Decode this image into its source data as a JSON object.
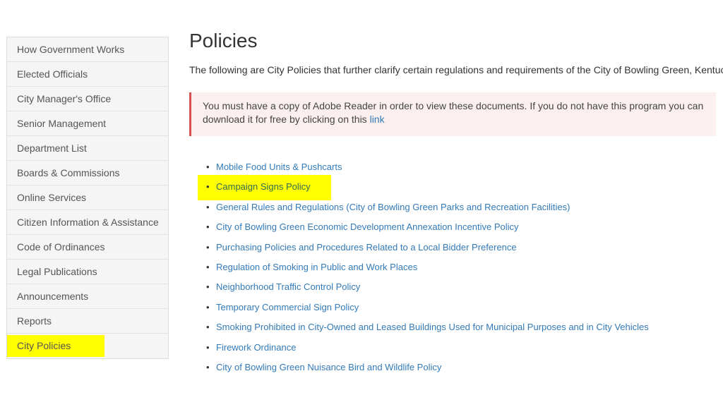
{
  "sidebar": {
    "items": [
      {
        "label": "How Government Works"
      },
      {
        "label": "Elected Officials"
      },
      {
        "label": "City Manager's Office"
      },
      {
        "label": "Senior Management"
      },
      {
        "label": "Department List"
      },
      {
        "label": "Boards & Commissions"
      },
      {
        "label": "Online Services"
      },
      {
        "label": "Citizen Information & Assistance"
      },
      {
        "label": "Code of Ordinances"
      },
      {
        "label": "Legal Publications"
      },
      {
        "label": "Announcements"
      },
      {
        "label": "Reports"
      },
      {
        "label": "City Policies",
        "active": true
      }
    ]
  },
  "main": {
    "title": "Policies",
    "intro": "The following are City Policies that further clarify certain regulations and requirements of the City of Bowling Green, Kentucky.",
    "alert": {
      "text_line1": "You must have a copy of Adobe Reader in order to view these documents. If you do not have this program you can",
      "text_line2": "download it for free by clicking on this",
      "link_label": "link"
    },
    "policies": [
      {
        "label": "Mobile Food Units & Pushcarts"
      },
      {
        "label": "Campaign Signs Policy",
        "highlighted": true
      },
      {
        "label": "General Rules and Regulations (City of Bowling Green Parks and Recreation Facilities)"
      },
      {
        "label": "City of Bowling Green Economic Development Annexation Incentive Policy"
      },
      {
        "label": "Purchasing Policies and Procedures Related to a Local Bidder Preference"
      },
      {
        "label": "Regulation of Smoking in Public and Work Places"
      },
      {
        "label": "Neighborhood Traffic Control Policy"
      },
      {
        "label": "Temporary Commercial Sign Policy"
      },
      {
        "label": "Smoking Prohibited in City-Owned and Leased Buildings Used for Municipal Purposes and in City Vehicles"
      },
      {
        "label": "Firework Ordinance"
      },
      {
        "label": "City of Bowling Green Nuisance Bird and Wildlife Policy"
      }
    ]
  },
  "colors": {
    "link": "#337ab7",
    "highlight": "#ffff00",
    "alert_border": "#d9534f",
    "alert_bg": "#fbf0ef",
    "sidebar_bg": "#f5f5f5"
  }
}
